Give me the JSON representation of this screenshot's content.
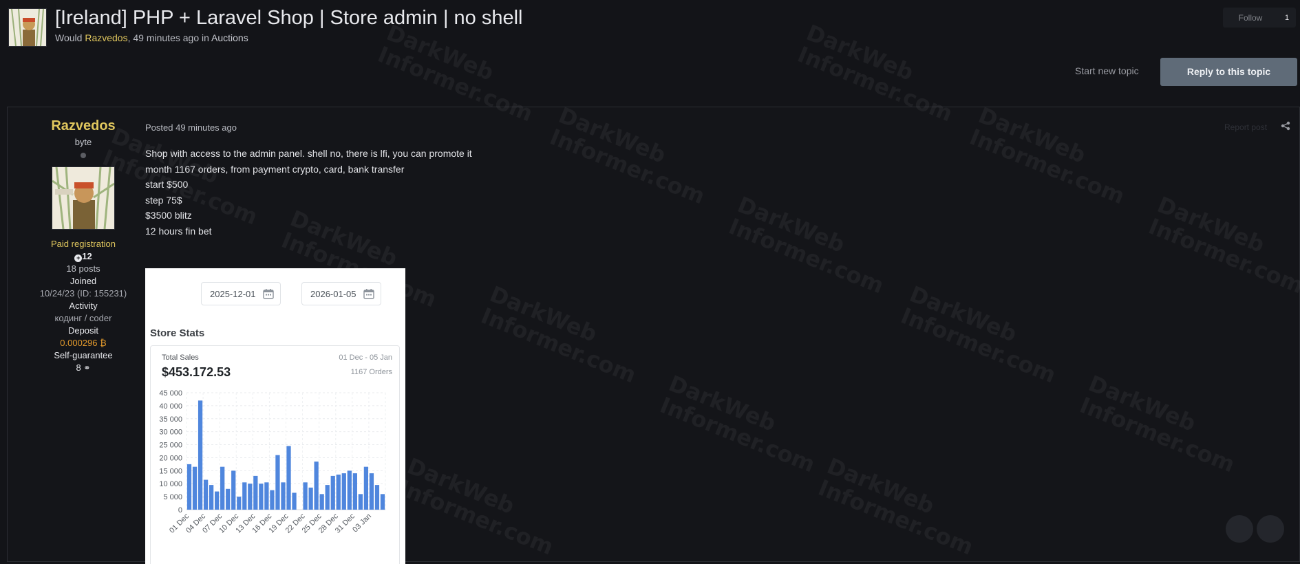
{
  "topic": {
    "title": "[Ireland] PHP + Laravel Shop | Store admin | no shell",
    "meta_prefix": "Would ",
    "author": "Razvedos",
    "meta_time": ", 49 minutes ago in ",
    "forum": "Auctions"
  },
  "actions": {
    "follow_label": "Follow",
    "follow_count": "1",
    "start_topic": "Start new topic",
    "reply": "Reply to this topic"
  },
  "author_panel": {
    "name": "Razvedos",
    "rank": "byte",
    "group": "Paid registration",
    "reputation": "12",
    "posts": "18 posts",
    "joined_label": "Joined",
    "joined_value": "10/24/23 (ID: 155231)",
    "activity_label": "Activity",
    "activity_value": "кодинг / coder",
    "deposit_label": "Deposit",
    "deposit_value": "0.000296 ₿",
    "guarantee_label": "Self-guarantee",
    "guarantee_value": "8"
  },
  "post": {
    "posted": "Posted 49 minutes ago",
    "report": "Report post",
    "lines": [
      "Shop with access to the admin panel. shell no, there is lfi, you can promote it",
      "month 1167 orders, from payment crypto, card, bank transfer",
      "start $500",
      "step 75$",
      "$3500 blitz",
      "12 hours fin bet"
    ]
  },
  "screenshot": {
    "date_from": "2025-12-01",
    "date_to": "2026-01-05",
    "stats_title": "Store Stats",
    "total_label": "Total Sales",
    "total_value": "$453.172.53",
    "range": "01 Dec - 05 Jan",
    "orders": "1167 Orders"
  },
  "watermark": [
    "DarkWeb",
    "Informer.com"
  ],
  "colors": {
    "accent_author": "#e0c75e",
    "reply_button": "#5f6b78",
    "bars": "#4f86dd",
    "deposit": "#e39a2c"
  },
  "chart_data": {
    "type": "bar",
    "xlabel": "",
    "ylabel": "",
    "ylim": [
      0,
      45000
    ],
    "yticks": [
      "45 000",
      "40 000",
      "35 000",
      "30 000",
      "25 000",
      "20 000",
      "15 000",
      "10 000",
      "5 000",
      "0"
    ],
    "categories": [
      "01 Dec",
      "02 Dec",
      "03 Dec",
      "04 Dec",
      "05 Dec",
      "06 Dec",
      "07 Dec",
      "08 Dec",
      "09 Dec",
      "10 Dec",
      "11 Dec",
      "12 Dec",
      "13 Dec",
      "14 Dec",
      "15 Dec",
      "16 Dec",
      "17 Dec",
      "18 Dec",
      "19 Dec",
      "20 Dec",
      "21 Dec",
      "22 Dec",
      "23 Dec",
      "24 Dec",
      "25 Dec",
      "26 Dec",
      "27 Dec",
      "28 Dec",
      "29 Dec",
      "30 Dec",
      "31 Dec",
      "01 Jan",
      "02 Jan",
      "03 Jan",
      "04 Jan",
      "05 Jan"
    ],
    "values": [
      17500,
      16500,
      42000,
      11500,
      9500,
      7000,
      16500,
      8000,
      15000,
      5000,
      10500,
      10000,
      13000,
      10000,
      10500,
      7500,
      21000,
      10500,
      24500,
      6500,
      0,
      10500,
      8500,
      18500,
      6000,
      9500,
      13000,
      13500,
      14000,
      15000,
      14000,
      6000,
      16500,
      14000,
      9500,
      6000
    ],
    "tick_labels": [
      "01 Dec",
      "04 Dec",
      "07 Dec",
      "10 Dec",
      "13 Dec",
      "16 Dec",
      "19 Dec",
      "22 Dec",
      "25 Dec",
      "28 Dec",
      "31 Dec",
      "03 Jan"
    ],
    "grid": true
  }
}
